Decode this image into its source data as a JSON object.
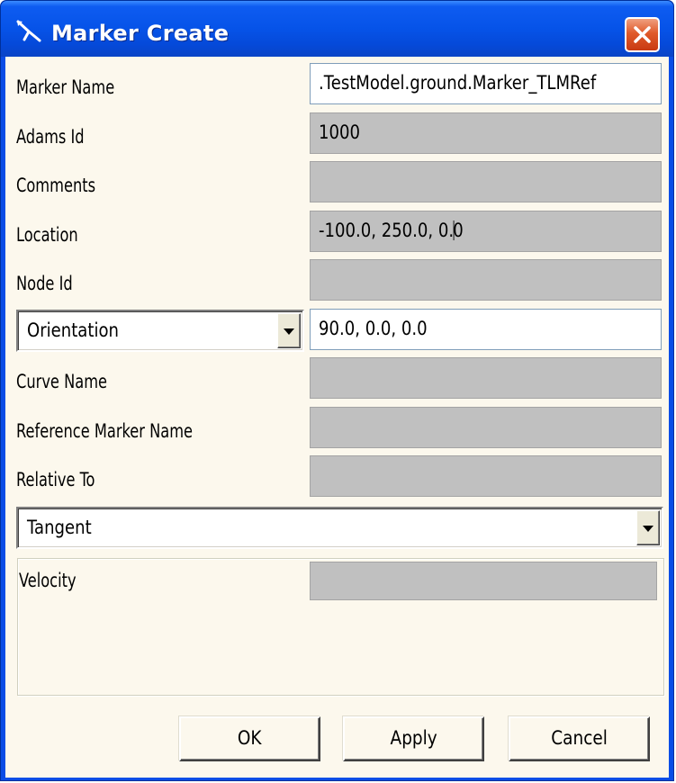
{
  "window": {
    "title": "Marker Create",
    "title_icon": "marker-arrow-icon",
    "close_icon": "close-icon"
  },
  "form": {
    "marker_name": {
      "label": "Marker Name",
      "value": ".TestModel.ground.Marker_TLMRef"
    },
    "adams_id": {
      "label": "Adams Id",
      "value": "1000"
    },
    "comments": {
      "label": "Comments",
      "value": ""
    },
    "location": {
      "label": "Location",
      "value_before_caret": "-100.0, 250.0, 0.",
      "value_after_caret": "0"
    },
    "node_id": {
      "label": "Node Id",
      "value": ""
    },
    "orientation": {
      "selected": "Orientation",
      "value": "90.0, 0.0, 0.0"
    },
    "curve_name": {
      "label": "Curve Name",
      "value": ""
    },
    "reference_marker_name": {
      "label": "Reference Marker Name",
      "value": ""
    },
    "relative_to": {
      "label": "Relative To",
      "value": ""
    },
    "tangent": {
      "selected": "Tangent"
    },
    "velocity": {
      "label": "Velocity",
      "value": ""
    }
  },
  "buttons": {
    "ok": "OK",
    "apply": "Apply",
    "cancel": "Cancel"
  },
  "colors": {
    "titlebar": "#0653e8",
    "client_bg": "#fcf8ed",
    "disabled_field": "#c0c0c0",
    "close_button": "#e05a2a"
  }
}
